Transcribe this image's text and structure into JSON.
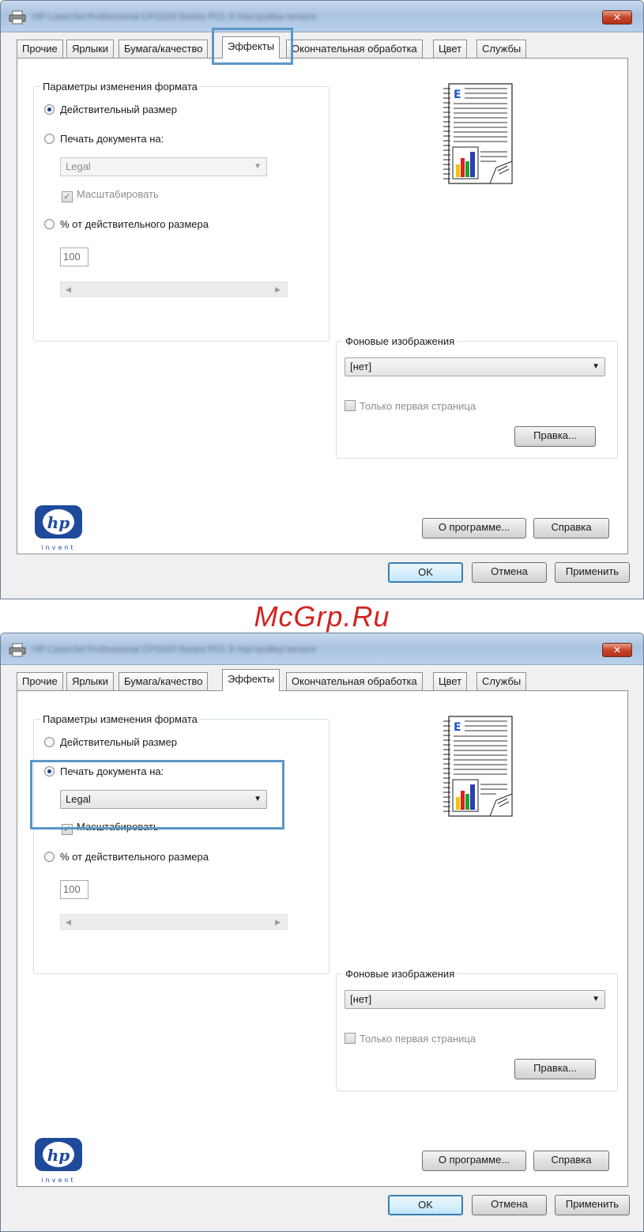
{
  "watermark": "McGrp.Ru",
  "window": {
    "title": "HP LaserJet Professional CP1520 Series PCL 6 Настройка печати",
    "close_glyph": "✕"
  },
  "tabs": [
    {
      "label": "Прочие"
    },
    {
      "label": "Ярлыки"
    },
    {
      "label": "Бумага/качество"
    },
    {
      "label": "Эффекты"
    },
    {
      "label": "Окончательная обработка"
    },
    {
      "label": "Цвет"
    },
    {
      "label": "Службы"
    }
  ],
  "format_group": {
    "legend": "Параметры изменения формата",
    "actual_size": "Действительный размер",
    "print_on": "Печать документа на:",
    "paper_size": "Legal",
    "scale_to_fit": "Масштабировать",
    "percent": "% от действительного размера",
    "percent_value": "100"
  },
  "background_group": {
    "legend": "Фоновые изображения",
    "selected": "[нет]",
    "first_page_only": "Только первая страница",
    "edit": "Правка..."
  },
  "buttons": {
    "about": "О программе...",
    "help": "Справка",
    "ok": "OK",
    "cancel": "Отмена",
    "apply": "Применить"
  },
  "logo": {
    "text": "hp",
    "tagline": "invent"
  },
  "preview": {
    "letter": "E"
  },
  "icons": {
    "checkmark": "✓",
    "dropdown": "▼",
    "scroll_left": "◀",
    "scroll_right": "▶"
  },
  "colors": {
    "highlight": "#5b97c8",
    "hp_blue": "#1f4a9c",
    "watermark": "#d32222"
  }
}
